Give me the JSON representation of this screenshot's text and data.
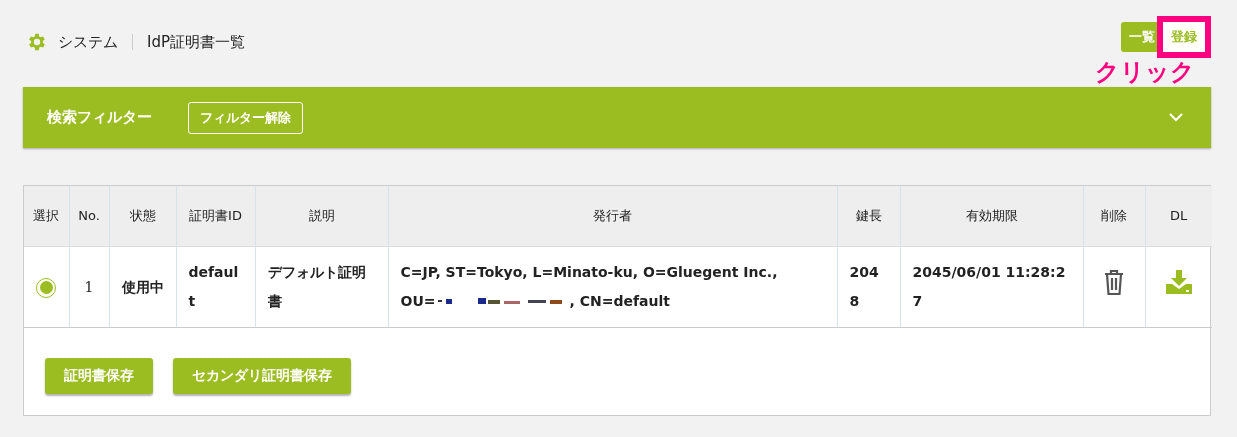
{
  "breadcrumb": {
    "section": "システム",
    "page": "IdP証明書一覧"
  },
  "nav_tabs": [
    {
      "label": "一覧",
      "selected": true
    },
    {
      "label": "登録",
      "selected": false,
      "highlighted": true
    }
  ],
  "annotation": "クリック",
  "filter": {
    "title": "検索フィルター",
    "clear_button": "フィルター解除",
    "expanded": false
  },
  "table": {
    "columns": [
      "選択",
      "No.",
      "状態",
      "証明書ID",
      "説明",
      "発行者",
      "鍵長",
      "有効期限",
      "削除",
      "DL"
    ],
    "rows": [
      {
        "selected": true,
        "no": "1",
        "status": "使用中",
        "cert_id": "default",
        "description": "デフォルト証明書",
        "issuer_line1": "C=JP, ST=Tokyo, L=Minato-ku, O=Gluegent Inc.,",
        "issuer_ou": "OU=",
        "issuer_tail": ", CN=default",
        "key_length": "2048",
        "expires": "2045/06/01 11:28:27"
      }
    ]
  },
  "buttons": [
    "証明書保存",
    "セカンダリ証明書保存"
  ]
}
